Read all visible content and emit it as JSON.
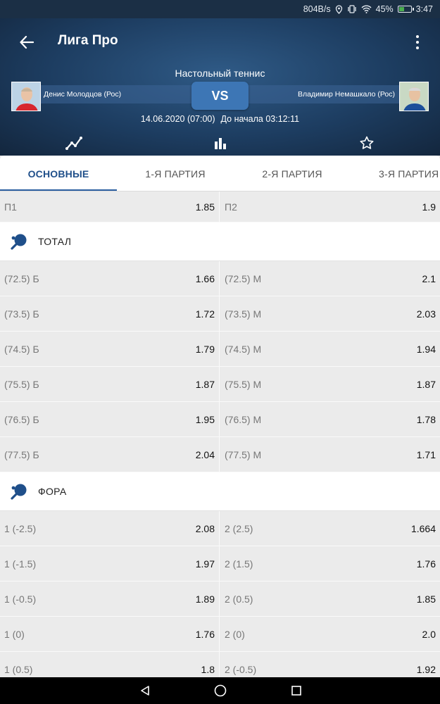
{
  "status_bar": {
    "speed": "804B/s",
    "battery_pct": "45%",
    "time": "3:47"
  },
  "header": {
    "title": "Лига Про",
    "sport": "Настольный теннис",
    "player1": "Денис Молодцов (Рос)",
    "player2": "Владимир Немашкало (Рос)",
    "vs": "VS",
    "date": "14.06.2020 (07:00)",
    "countdown": "До начала 03:12:11"
  },
  "tabs": [
    "ОСНОВНЫЕ",
    "1-Я ПАРТИЯ",
    "2-Я ПАРТИЯ",
    "3-Я ПАРТИЯ"
  ],
  "winner": {
    "left_label": "П1",
    "left_value": "1.85",
    "right_label": "П2",
    "right_value": "1.9"
  },
  "sections": {
    "total": {
      "title": "ТОТАЛ",
      "rows": [
        {
          "l": "(72.5) Б",
          "lv": "1.66",
          "r": "(72.5) М",
          "rv": "2.1"
        },
        {
          "l": "(73.5) Б",
          "lv": "1.72",
          "r": "(73.5) М",
          "rv": "2.03"
        },
        {
          "l": "(74.5) Б",
          "lv": "1.79",
          "r": "(74.5) М",
          "rv": "1.94"
        },
        {
          "l": "(75.5) Б",
          "lv": "1.87",
          "r": "(75.5) М",
          "rv": "1.87"
        },
        {
          "l": "(76.5) Б",
          "lv": "1.95",
          "r": "(76.5) М",
          "rv": "1.78"
        },
        {
          "l": "(77.5) Б",
          "lv": "2.04",
          "r": "(77.5) М",
          "rv": "1.71"
        }
      ]
    },
    "fora": {
      "title": "ФОРА",
      "rows": [
        {
          "l": "1 (-2.5)",
          "lv": "2.08",
          "r": "2 (2.5)",
          "rv": "1.664"
        },
        {
          "l": "1 (-1.5)",
          "lv": "1.97",
          "r": "2 (1.5)",
          "rv": "1.76"
        },
        {
          "l": "1 (-0.5)",
          "lv": "1.89",
          "r": "2 (0.5)",
          "rv": "1.85"
        },
        {
          "l": "1 (0)",
          "lv": "1.76",
          "r": "2 (0)",
          "rv": "2.0"
        },
        {
          "l": "1 (0.5)",
          "lv": "1.8",
          "r": "2 (-0.5)",
          "rv": "1.92"
        }
      ]
    }
  },
  "colors": {
    "header": "#1d3d61",
    "accent": "#2a5d9f",
    "vs": "#3d76b5"
  },
  "icons": {
    "back": "arrow-left-icon",
    "more": "more-vert-icon",
    "stats": "chart-line-icon",
    "bars": "bar-chart-icon",
    "favorite": "star-icon",
    "section": "ping-pong-icon"
  }
}
